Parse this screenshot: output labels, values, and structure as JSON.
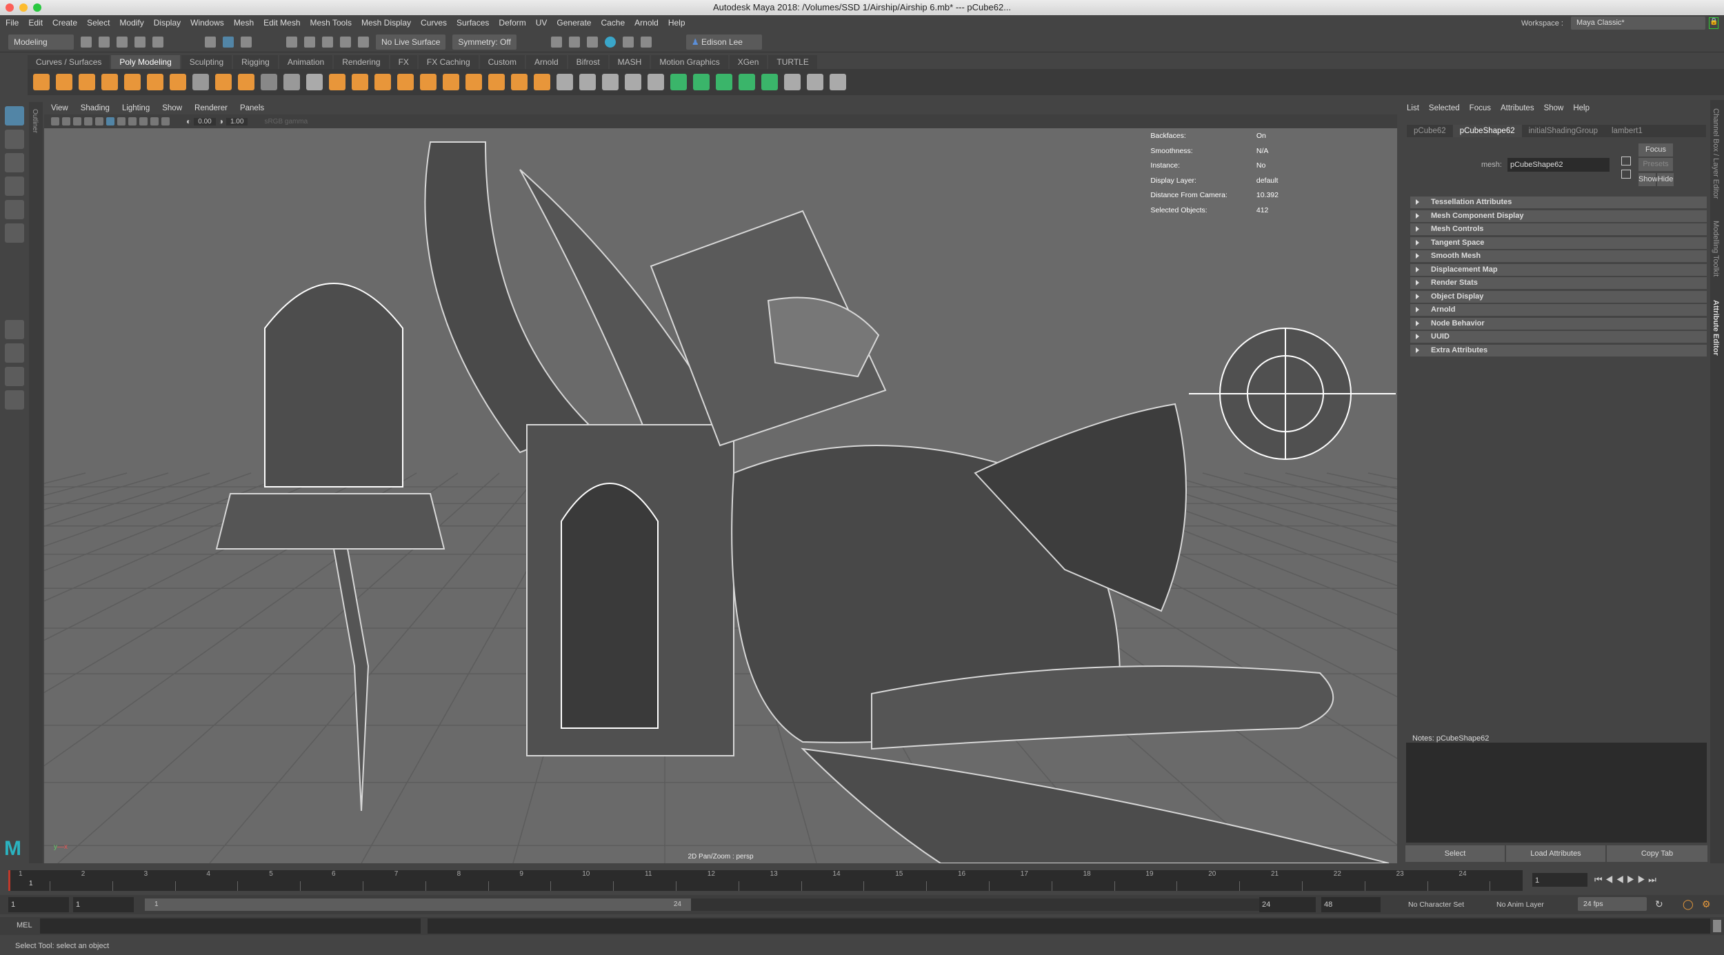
{
  "window": {
    "title": "Autodesk Maya 2018: /Volumes/SSD 1/Airship/Airship 6.mb*  ---  pCube62..."
  },
  "menubar": [
    "File",
    "Edit",
    "Create",
    "Select",
    "Modify",
    "Display",
    "Windows",
    "Mesh",
    "Edit Mesh",
    "Mesh Tools",
    "Mesh Display",
    "Curves",
    "Surfaces",
    "Deform",
    "UV",
    "Generate",
    "Cache",
    "Arnold",
    "Help"
  ],
  "statusline": {
    "menuset": "Modeling",
    "live_surface": "No Live Surface",
    "symmetry": "Symmetry: Off",
    "user": "Edison Lee",
    "workspace_label": "Workspace :",
    "workspace": "Maya Classic*"
  },
  "shelf": {
    "tabs": [
      "Curves / Surfaces",
      "Poly Modeling",
      "Sculpting",
      "Rigging",
      "Animation",
      "Rendering",
      "FX",
      "FX Caching",
      "Custom",
      "Arnold",
      "Bifrost",
      "MASH",
      "Motion Graphics",
      "XGen",
      "TURTLE"
    ],
    "active": "Poly Modeling"
  },
  "viewport": {
    "menu": [
      "View",
      "Shading",
      "Lighting",
      "Show",
      "Renderer",
      "Panels"
    ],
    "exposure": "0.00",
    "gamma": "1.00",
    "colorspace": "sRGB gamma",
    "camera_label": "2D Pan/Zoom : persp",
    "hud": [
      {
        "label": "Backfaces:",
        "value": "On"
      },
      {
        "label": "Smoothness:",
        "value": "N/A"
      },
      {
        "label": "Instance:",
        "value": "No"
      },
      {
        "label": "Display Layer:",
        "value": "default"
      },
      {
        "label": "Distance From Camera:",
        "value": "10.392"
      },
      {
        "label": "Selected Objects:",
        "value": "412"
      }
    ]
  },
  "attribute_editor": {
    "menu": [
      "List",
      "Selected",
      "Focus",
      "Attributes",
      "Show",
      "Help"
    ],
    "tabs": [
      "pCube62",
      "pCubeShape62",
      "initialShadingGroup",
      "lambert1"
    ],
    "active_tab": "pCubeShape62",
    "mesh_label": "mesh:",
    "mesh_value": "pCubeShape62",
    "focus": "Focus",
    "presets": "Presets",
    "show": "Show",
    "hide": "Hide",
    "sections": [
      "Tessellation Attributes",
      "Mesh Component Display",
      "Mesh Controls",
      "Tangent Space",
      "Smooth Mesh",
      "Displacement Map",
      "Render Stats",
      "Object Display",
      "Arnold",
      "Node Behavior",
      "UUID",
      "Extra Attributes"
    ],
    "notes": "Notes:  pCubeShape62",
    "buttons": [
      "Select",
      "Load Attributes",
      "Copy Tab"
    ]
  },
  "side_tabs": [
    "Channel Box / Layer Editor",
    "Modelling Toolkit",
    "Attribute Editor"
  ],
  "outliner_tab": "Outliner",
  "timeline": {
    "ticks": [
      "1",
      "2",
      "3",
      "4",
      "5",
      "6",
      "7",
      "8",
      "9",
      "10",
      "11",
      "12",
      "13",
      "14",
      "15",
      "16",
      "17",
      "18",
      "19",
      "20",
      "21",
      "22",
      "23",
      "24"
    ],
    "current_frame": "1",
    "playhead": "1"
  },
  "range": {
    "start": "1",
    "start2": "1",
    "slider_start": "1",
    "slider_end": "24",
    "end": "24",
    "end2": "48",
    "character_set": "No Character Set",
    "anim_layer": "No Anim Layer",
    "fps": "24 fps"
  },
  "command": {
    "label": "MEL"
  },
  "help_line": "Select Tool: select an object",
  "colors": {
    "bg": "#444444",
    "viewport": "#6a6a6a",
    "accent": "#5285a6",
    "playhead": "#c0392b"
  }
}
